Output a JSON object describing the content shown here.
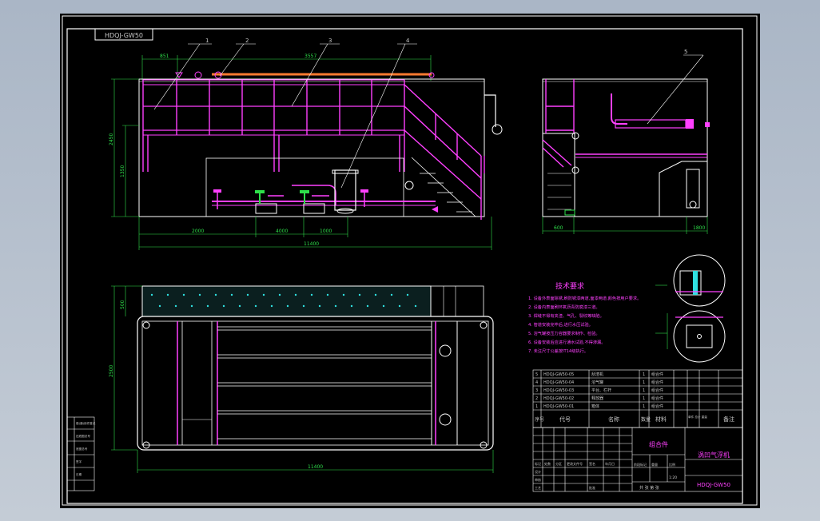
{
  "drawing_code": "HDQJ-GW50",
  "leaders": [
    "1",
    "2",
    "3",
    "4",
    "5"
  ],
  "front_view": {
    "dims_top": [
      "851",
      "3557"
    ],
    "dims_left": [
      "2450",
      "1350"
    ],
    "dims_bottom": [
      "2000",
      "4000",
      "1000"
    ],
    "dim_overall": "11400"
  },
  "side_view": {
    "dims_bottom": [
      "600",
      "1800"
    ]
  },
  "plan_view": {
    "dims_left": [
      "500",
      "2500"
    ],
    "dim_overall": "11400"
  },
  "tech_requirements": {
    "title": "技术要求",
    "items": [
      "1. 设备外表面除锈,刷防锈漆两道,面漆两道,颜色按用户要求。",
      "2. 设备内表面刷环氧沥青防腐漆三道。",
      "3. 焊缝不得有夹渣、气孔、裂纹等缺陷。",
      "4. 管道安装完毕后,进行水压试验。",
      "5. 溶气罐按压力容器要求制作、检验。",
      "6. 设备安装后应进行通水试验,不得渗漏。",
      "7. 未注尺寸公差按IT14级执行。"
    ]
  },
  "bom": {
    "rows": [
      {
        "no": "5",
        "code": "HDQJ-GW50-05",
        "name": "刮渣机",
        "qty": "1",
        "material": "组合件"
      },
      {
        "no": "4",
        "code": "HDQJ-GW50-04",
        "name": "溶气罐",
        "qty": "1",
        "material": "组合件"
      },
      {
        "no": "3",
        "code": "HDQJ-GW50-03",
        "name": "平台、栏杆",
        "qty": "1",
        "material": "组合件"
      },
      {
        "no": "2",
        "code": "HDQJ-GW50-02",
        "name": "释放器",
        "qty": "1",
        "material": "组合件"
      },
      {
        "no": "1",
        "code": "HDQJ-GW50-01",
        "name": "箱体",
        "qty": "1",
        "material": "组合件"
      }
    ],
    "headers": [
      "序号",
      "代号",
      "名称",
      "数量",
      "材料",
      "单件 总计 重量",
      "备注"
    ]
  },
  "title_block": {
    "material": "组合件",
    "product_name": "涡凹气浮机",
    "drawing_no": "HDQJ-GW50",
    "labels": [
      "标记",
      "处数",
      "分区",
      "更改文件号",
      "签名",
      "年月日"
    ],
    "roles": [
      "设计",
      "审核",
      "工艺",
      "批准"
    ],
    "stage_label": "阶段标记",
    "weight_label": "重量",
    "scale_label": "比例",
    "scale": "1:20",
    "sheet_info": "共  张  第  张"
  },
  "left_table": [
    "借(通)用件登记",
    "旧底图总号",
    "底图总号",
    "签字",
    "日期"
  ],
  "colors": {
    "paper": "#000000",
    "line": "#ffffff",
    "pipe": "#ff40ff",
    "dim": "#2ee04a",
    "text": "#c8c8c8"
  }
}
